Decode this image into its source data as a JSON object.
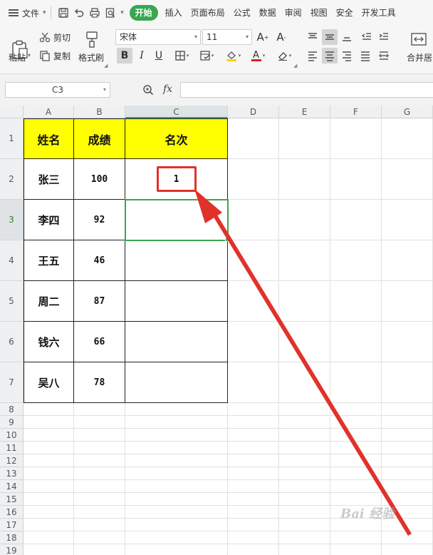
{
  "menubar": {
    "file_label": "文件",
    "tabs": [
      "开始",
      "插入",
      "页面布局",
      "公式",
      "数据",
      "审阅",
      "视图",
      "安全",
      "开发工具"
    ],
    "active_tab": "开始"
  },
  "ribbon": {
    "paste_label": "粘贴",
    "cut_label": "剪切",
    "copy_label": "复制",
    "format_painter_label": "格式刷",
    "font_name": "宋体",
    "font_size": "11",
    "merge_center_label": "合并居"
  },
  "formula_bar": {
    "name_box": "C3",
    "fx_label": "fx",
    "formula": ""
  },
  "sheet": {
    "columns": [
      "A",
      "B",
      "C",
      "D",
      "E",
      "F",
      "G"
    ],
    "selected_column": "C",
    "rows": [
      "1",
      "2",
      "3",
      "4",
      "5",
      "6",
      "7",
      "8",
      "9",
      "10",
      "11",
      "12",
      "13",
      "14",
      "15",
      "16",
      "17",
      "18",
      "19"
    ],
    "selected_row": "3",
    "table_headers": [
      "姓名",
      "成绩",
      "名次"
    ],
    "table_rows": [
      {
        "name": "张三",
        "score": "100",
        "rank": "1"
      },
      {
        "name": "李四",
        "score": "92",
        "rank": ""
      },
      {
        "name": "王五",
        "score": "46",
        "rank": ""
      },
      {
        "name": "周二",
        "score": "87",
        "rank": ""
      },
      {
        "name": "钱六",
        "score": "66",
        "rank": ""
      },
      {
        "name": "吴八",
        "score": "78",
        "rank": ""
      }
    ]
  },
  "colors": {
    "header_fill": "#ffff00",
    "active_tab": "#39a651",
    "selection": "#3ea54f",
    "annotation": "#e0322a"
  },
  "watermark": "Bai 经验"
}
